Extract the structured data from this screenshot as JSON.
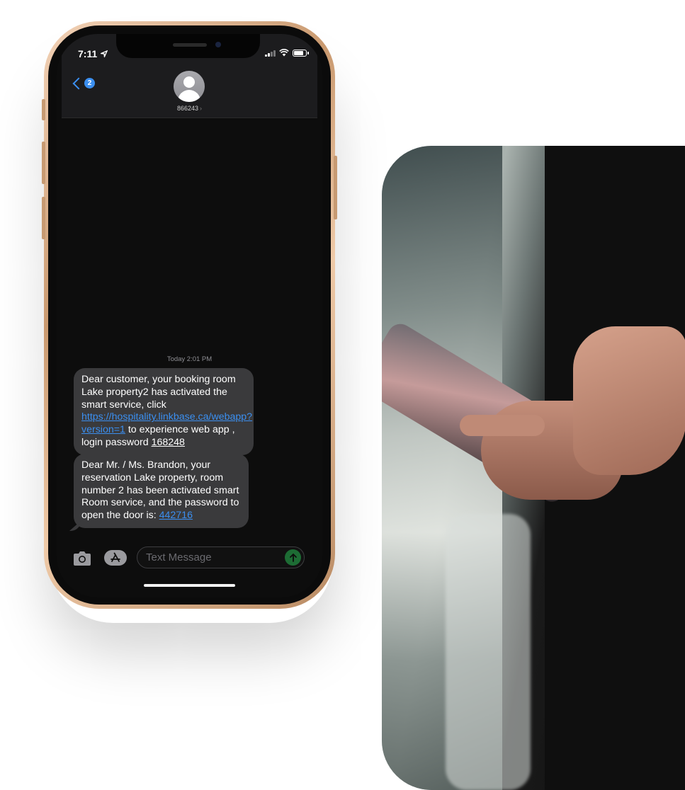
{
  "status_bar": {
    "time": "7:11",
    "location_icon": "location-arrow-icon",
    "icons": [
      "signal-icon",
      "wifi-icon",
      "battery-icon"
    ]
  },
  "header": {
    "back_badge": "2",
    "contact_name": "866243",
    "contact_chevron": "›"
  },
  "conversation": {
    "timestamp": "Today 2:01 PM",
    "messages": [
      {
        "text_before_link": "Dear customer, your booking room Lake property2 has activated the smart service, click ",
        "link": "https://hospitality.linkbase.ca/webapp?version=1",
        "text_after_link": " to experience web app , login password ",
        "password": "168248"
      },
      {
        "text": "Dear Mr. / Ms. Brandon, your reservation Lake property, room number 2 has been activated smart Room service, and the password to open the door is: ",
        "code": "442716"
      }
    ]
  },
  "input_bar": {
    "placeholder": "Text Message",
    "icons": [
      "camera-icon",
      "app-store-icon",
      "send-arrow-icon"
    ]
  },
  "colors": {
    "accent_blue": "#3b8ff0",
    "bubble_gray": "#3a3a3c",
    "send_green": "#1d6c34",
    "frame_gold": "#d9aa80"
  }
}
